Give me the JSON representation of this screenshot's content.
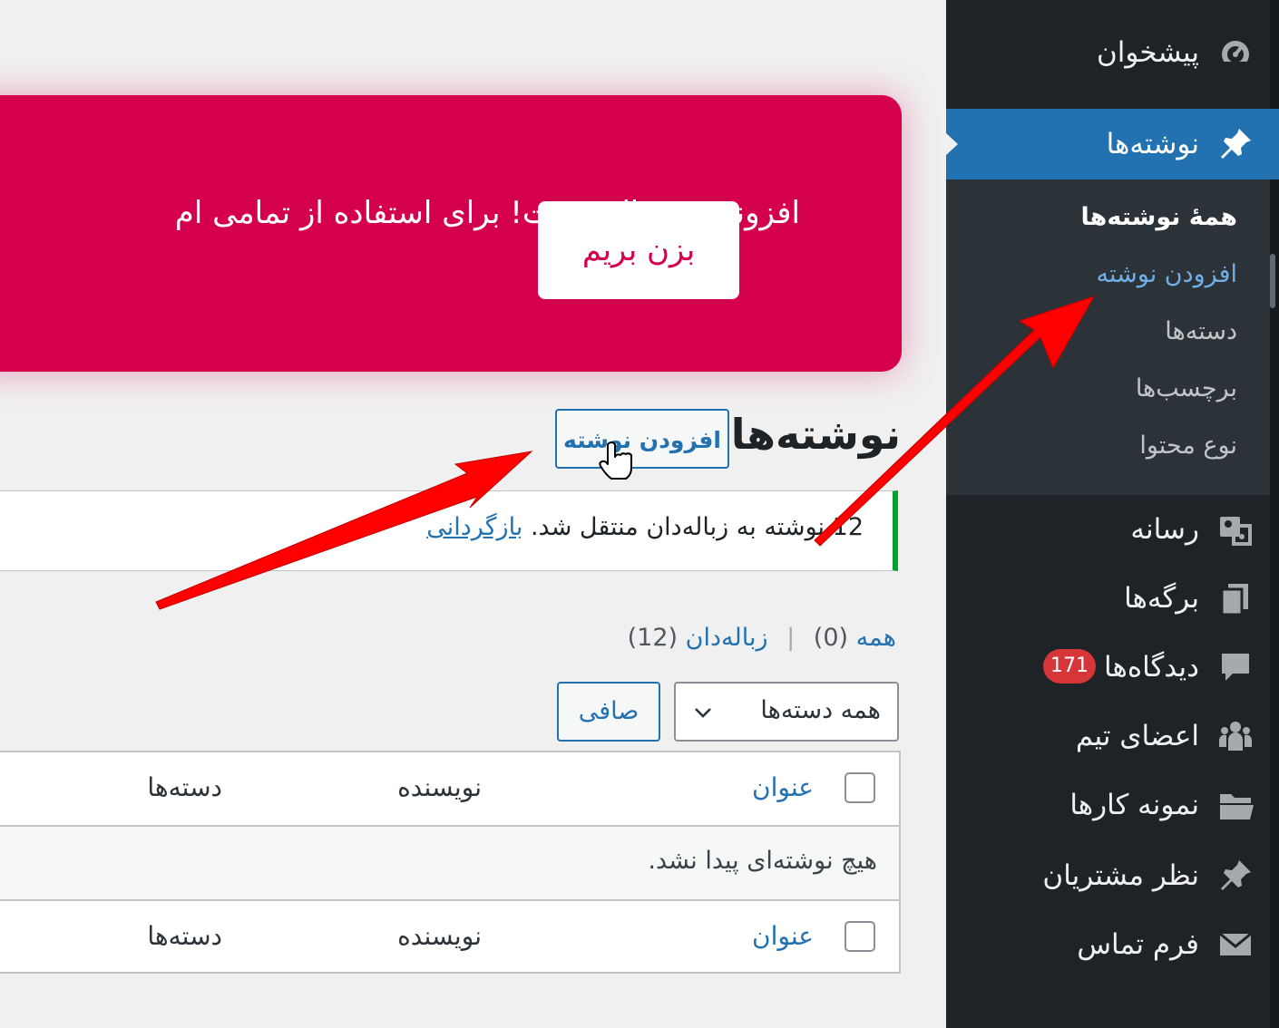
{
  "sidebar": {
    "dashboard": "پیشخوان",
    "posts": "نوشته‌ها",
    "submenu": {
      "all_posts": "همهٔ نوشته‌ها",
      "add_new": "افزودن نوشته",
      "categories": "دسته‌ها",
      "tags": "برچسب‌ها",
      "content_type": "نوع محتوا"
    },
    "media": "رسانه",
    "pages": "برگه‌ها",
    "comments": "دیدگاه‌ها",
    "comments_count": "171",
    "team_members": "اعضای تیم",
    "portfolio": "نمونه کارها",
    "testimonials": "نظر مشتریان",
    "contact_form": "فرم تماس"
  },
  "banner": {
    "text": "افزونه … فعال نیست! برای استفاده از تمامی ام",
    "button": "بزن بریم",
    "color": "#d5004d"
  },
  "header": {
    "title": "نوشته‌ها",
    "add_new": "افزودن نوشته"
  },
  "notice": {
    "message": "12 نوشته به زباله‌دان منتقل شد.",
    "undo": "بازگردانی"
  },
  "status_filter": {
    "all_label": "همه",
    "all_count": "(0)",
    "trash_label": "زباله‌دان",
    "trash_count": "(12)"
  },
  "filters": {
    "category_selected": "همه دسته‌ها",
    "filter_button": "صافی"
  },
  "table": {
    "columns": {
      "title": "عنوان",
      "author": "نویسنده",
      "categories": "دسته‌ها"
    },
    "empty_message": "هیچ نوشته‌ای پیدا نشد."
  },
  "colors": {
    "accent": "#2271b1",
    "sidebar_bg": "#1d2327",
    "badge": "#d63638",
    "notice_success": "#00a32a",
    "annotation_arrow": "#ff0000"
  }
}
